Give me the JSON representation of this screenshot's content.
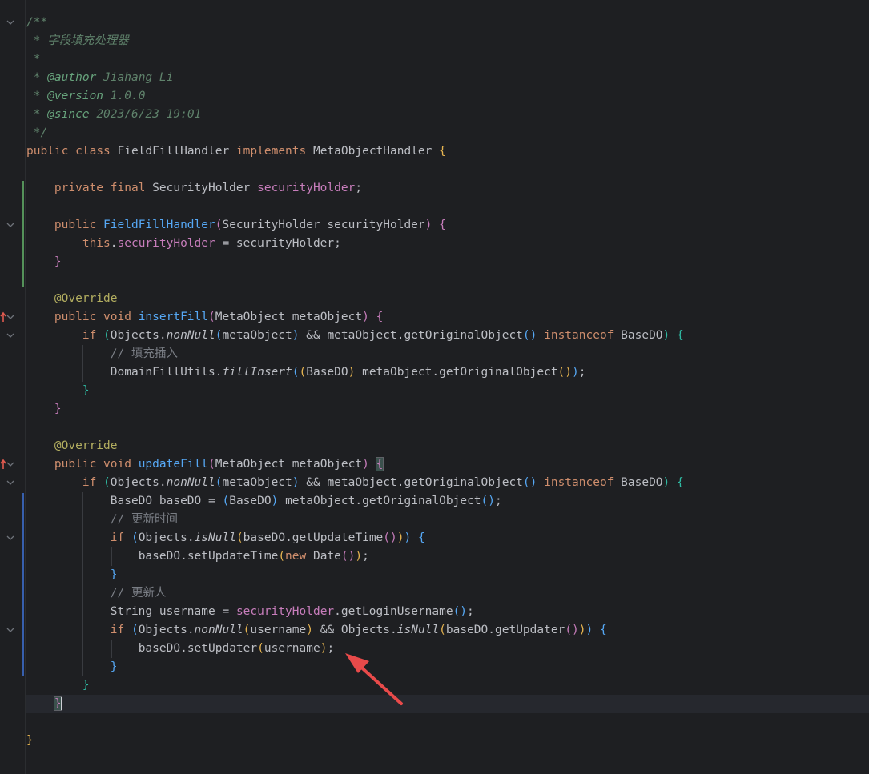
{
  "editor": {
    "lines": {
      "l1": "/**",
      "l2": " * 字段填充处理器",
      "l3": " *",
      "l4_tag": "@author",
      "l4_val": "Jiahang Li",
      "l5_tag": "@version",
      "l5_val": "1.0.0",
      "l6_tag": "@since",
      "l6_val": "2023/6/23 19:01",
      "l7": " */",
      "cmt_insert": "// 填充插入",
      "cmt_update_time": "// 更新时间",
      "cmt_updater": "// 更新人"
    },
    "tokens": {
      "public": "public",
      "class": "class",
      "private": "private",
      "final": "final",
      "void": "void",
      "if": "if",
      "this": "this",
      "new": "new",
      "implements": "implements",
      "instanceof": "instanceof",
      "override": "@Override",
      "FieldFillHandler": "FieldFillHandler",
      "MetaObjectHandler": "MetaObjectHandler",
      "SecurityHolder": "SecurityHolder",
      "securityHolder": "securityHolder",
      "insertFill": "insertFill",
      "updateFill": "updateFill",
      "MetaObject": "MetaObject",
      "metaObject": "metaObject",
      "Objects": "Objects",
      "nonNull": "nonNull",
      "isNull": "isNull",
      "getOriginalObject": "getOriginalObject",
      "BaseDO": "BaseDO",
      "baseDO": "baseDO",
      "DomainFillUtils": "DomainFillUtils",
      "fillInsert": "fillInsert",
      "getUpdateTime": "getUpdateTime",
      "setUpdateTime": "setUpdateTime",
      "Date": "Date",
      "String": "String",
      "username": "username",
      "getLoginUsername": "getLoginUsername",
      "getUpdater": "getUpdater",
      "setUpdater": "setUpdater",
      "and": "&&",
      "eq": "="
    }
  },
  "colors": {
    "background": "#1e1f22",
    "keyword": "#cf8e6d",
    "method": "#56a8f5",
    "field": "#c77dbb",
    "annotation": "#b3ae60",
    "comment": "#7a7e85",
    "doc": "#5f826b",
    "vcs_added": "#549159",
    "vcs_modified": "#375fad",
    "arrow": "#e84a4a"
  },
  "icons": {
    "fold": "chevron-down-icon",
    "override": "override-method-icon",
    "annotation_arrow": "red-arrow-annotation"
  }
}
